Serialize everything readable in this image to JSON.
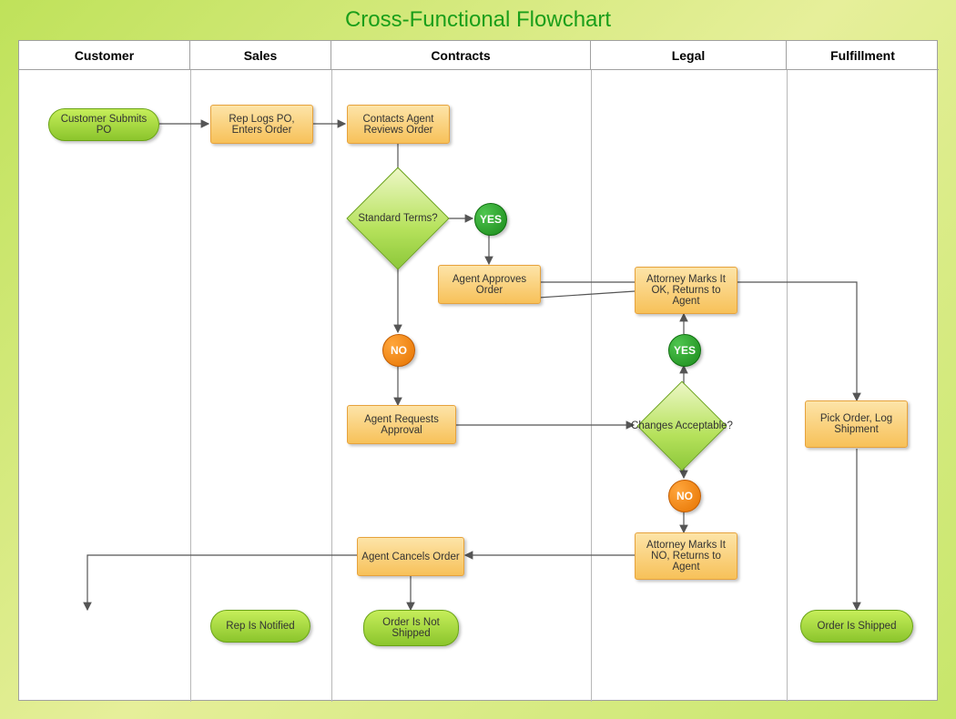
{
  "title": "Cross-Functional Flowchart",
  "lanes": {
    "customer": "Customer",
    "sales": "Sales",
    "contracts": "Contracts",
    "legal": "Legal",
    "fulfillment": "Fulfillment"
  },
  "nodes": {
    "customer_submits": "Customer Submits PO",
    "rep_logs": "Rep Logs PO, Enters Order",
    "contacts_agent": "Contacts Agent Reviews Order",
    "standard_terms": "Standard Terms?",
    "agent_approves": "Agent Approves Order",
    "agent_requests": "Agent Requests Approval",
    "agent_cancels": "Agent Cancels Order",
    "order_not_shipped": "Order Is Not Shipped",
    "rep_notified": "Rep Is Notified",
    "attorney_ok": "Attorney Marks It OK, Returns to Agent",
    "changes_acceptable": "Changes Acceptable?",
    "attorney_no": "Attorney Marks It NO, Returns to Agent",
    "pick_order": "Pick Order, Log Shipment",
    "order_shipped": "Order Is Shipped"
  },
  "decision_labels": {
    "yes": "YES",
    "no": "NO"
  }
}
